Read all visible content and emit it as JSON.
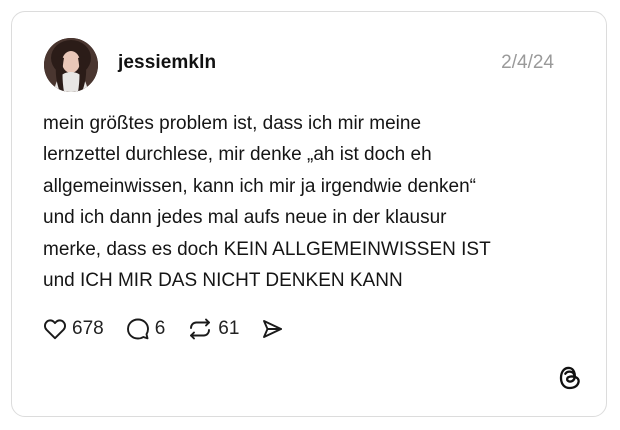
{
  "post": {
    "username": "jessiemkln",
    "date": "2/4/24",
    "lines": [
      "mein größtes problem ist, dass ich mir meine",
      "lernzettel durchlese, mir denke „ah ist doch eh",
      "allgemeinwissen, kann ich mir ja irgendwie denken“",
      "und ich dann jedes mal aufs neue in der klausur",
      "merke, dass es doch KEIN ALLGEMEINWISSEN IST",
      "und ICH MIR DAS NICHT DENKEN KANN"
    ]
  },
  "actions": {
    "likes": "678",
    "replies": "6",
    "reposts": "61"
  },
  "icons": {
    "like": "heart-icon",
    "reply": "comment-icon",
    "repost": "repost-icon",
    "share": "send-icon",
    "brand": "threads-logo-icon"
  },
  "colors": {
    "text": "#151515",
    "muted": "#9a9a9a",
    "border": "#dcdcdc"
  }
}
